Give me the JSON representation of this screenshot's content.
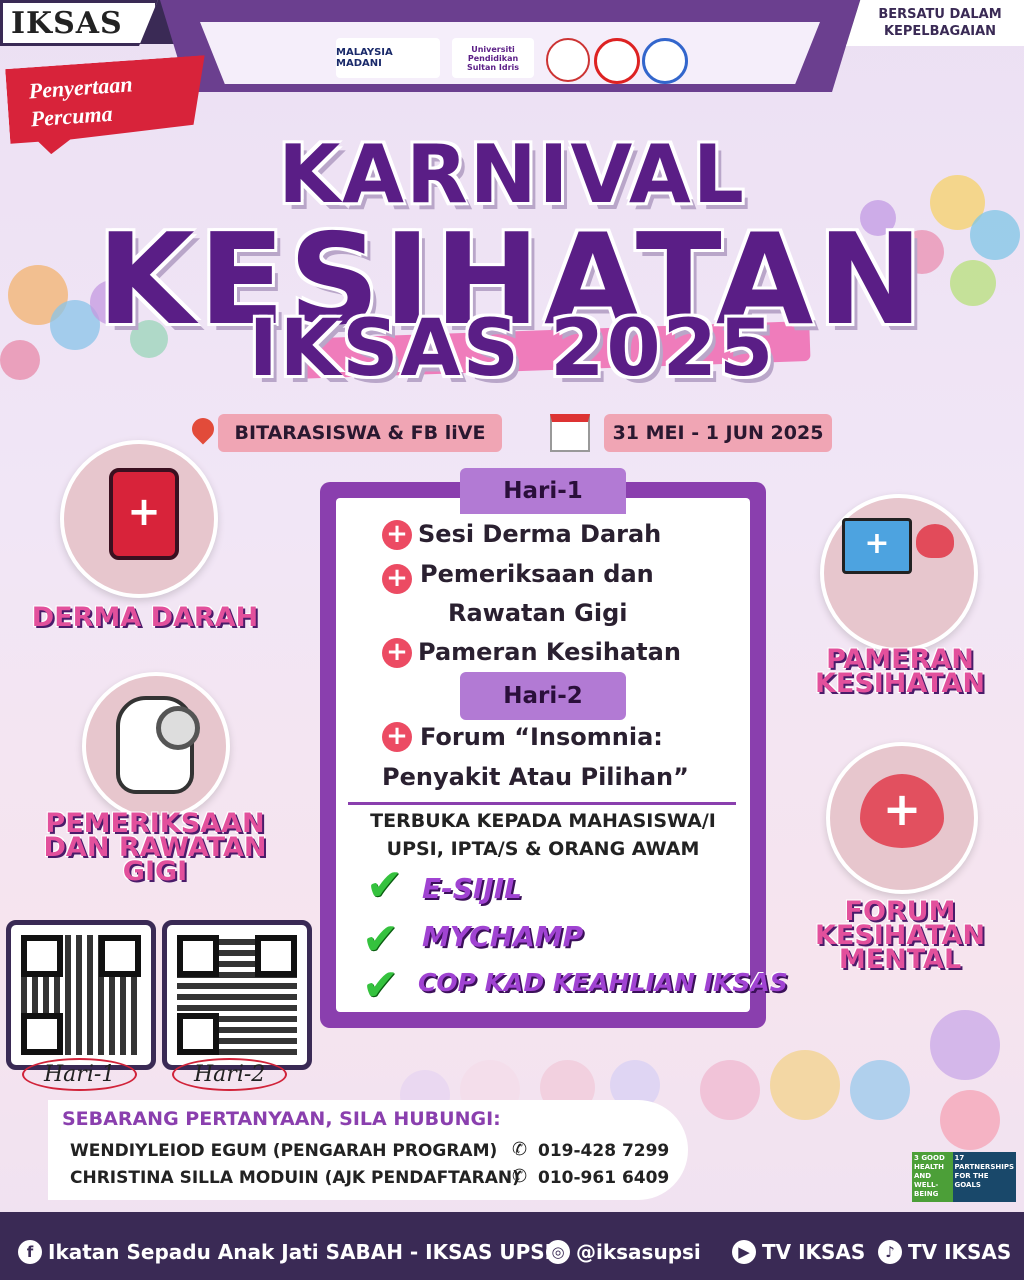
{
  "header": {
    "brand": "IKSAS",
    "motto_line1": "BERSATU DALAM",
    "motto_line2": "KEPELBAGAIAN",
    "logos": [
      "MALAYSIA MADANI",
      "Universiti Pendidikan Sultan Idris",
      "logo-3",
      "logo-4",
      "logo-5"
    ]
  },
  "ribbon": {
    "line1": "Penyertaan",
    "line2": "Percuma"
  },
  "title": {
    "line1": "KARNIVAL",
    "line2": "KESIHATAN",
    "line3": "IKSAS 2025"
  },
  "info": {
    "location": "BITARASISWA & FB liVE",
    "date": "31 MEI - 1 JUN 2025"
  },
  "features": {
    "left": [
      "DERMA DARAH",
      "PEMERIKSAAN",
      "DAN RAWATAN",
      "GIGI"
    ],
    "right": [
      "PAMERAN",
      "KESIHATAN",
      "FORUM",
      "KESIHATAN",
      "MENTAL"
    ]
  },
  "program": {
    "day1": "Hari-1",
    "day1_items": [
      "Sesi Derma Darah",
      "Pemeriksaan dan",
      "Rawatan Gigi",
      "Pameran Kesihatan"
    ],
    "day2": "Hari-2",
    "day2_items": [
      "Forum “Insomnia:",
      "Penyakit Atau Pilihan”"
    ],
    "open_line1": "TERBUKA KEPADA MAHASISWA/I",
    "open_line2": "UPSI, IPTA/S & ORANG AWAM",
    "perks": [
      "E-SIJIL",
      "MYCHAMP",
      "COP KAD KEAHLIAN IKSAS"
    ]
  },
  "qr": {
    "label1": "Hari-1",
    "label2": "Hari-2"
  },
  "contact": {
    "title": "SEBARANG PERTANYAAN, SILA HUBUNGI:",
    "p1_name": "WENDIYLEIOD EGUM (PENGARAH PROGRAM)",
    "p1_phone": "019-428 7299",
    "p2_name": "CHRISTINA SILLA MODUIN (AJK PENDAFTARAN)",
    "p2_phone": "010-961 6409"
  },
  "sdg": {
    "goal3_num": "3",
    "goal3": "GOOD HEALTH AND WELL-BEING",
    "goal17_num": "17",
    "goal17": "PARTNERSHIPS FOR THE GOALS"
  },
  "footer": {
    "facebook": "Ikatan Sepadu Anak Jati SABAH - IKSAS UPSI",
    "instagram": "@iksasupsi",
    "youtube": "TV IKSAS",
    "tiktok": "TV IKSAS"
  },
  "colors": {
    "purple": "#5a1e86",
    "card": "#8a3fae",
    "pink": "#f0a5b4",
    "red": "#d8233a",
    "navy": "#3a2a55"
  }
}
